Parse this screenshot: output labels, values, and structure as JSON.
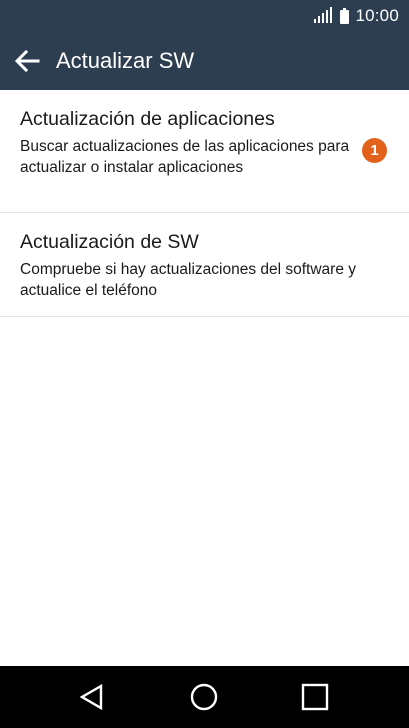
{
  "status_bar": {
    "time": "10:00",
    "icons": [
      "signal-icon",
      "battery-icon"
    ]
  },
  "app_bar": {
    "back_icon": "arrow-left-icon",
    "title": "Actualizar SW"
  },
  "list": {
    "items": [
      {
        "title": "Actualización de aplicaciones",
        "summary": "Buscar actualizaciones de las aplicaciones para actualizar o instalar aplicaciones",
        "badge": "1",
        "badge_color": "#e2621b"
      },
      {
        "title": "Actualización de SW",
        "summary": "Compruebe si hay actualizaciones del software y actualice el teléfono"
      }
    ]
  },
  "nav_bar": {
    "buttons": [
      "back-triangle-icon",
      "home-circle-icon",
      "recents-square-icon"
    ]
  },
  "colors": {
    "app_bar": "#2d3e50",
    "badge": "#e2621b",
    "nav_bar": "#000000"
  }
}
